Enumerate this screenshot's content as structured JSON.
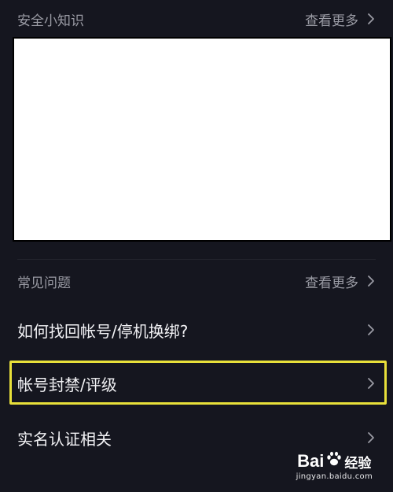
{
  "safety": {
    "title": "安全小知识",
    "more_label": "查看更多"
  },
  "faq": {
    "title": "常见问题",
    "more_label": "查看更多",
    "items": [
      {
        "label": "如何找回帐号/停机换绑?"
      },
      {
        "label": "帐号封禁/评级"
      },
      {
        "label": "实名认证相关"
      }
    ]
  },
  "watermark": {
    "brand_left": "Bai",
    "brand_right": "经验",
    "url": "jingyan.baidu.com"
  },
  "colors": {
    "background": "#15161f",
    "highlight": "#e8e03a",
    "muted_text": "#9a9ba4"
  }
}
